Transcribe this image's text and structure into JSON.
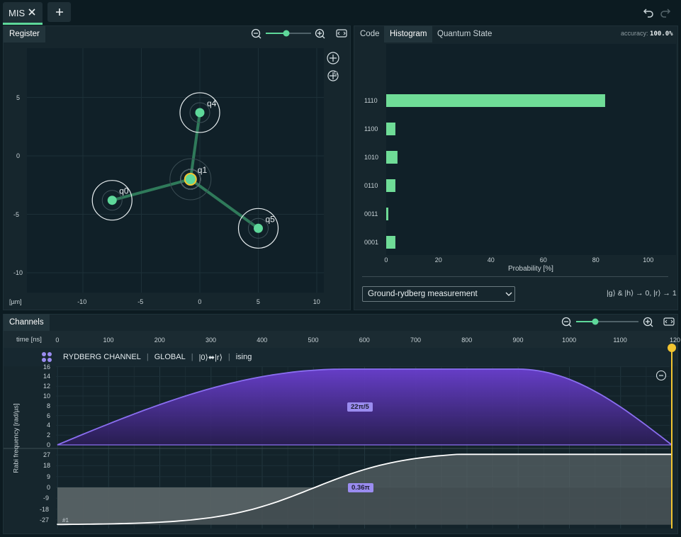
{
  "tabs": {
    "mis": "MIS"
  },
  "register": {
    "tab": "Register",
    "unit": "[µm]",
    "yticks": [
      "5",
      "0",
      "-5",
      "-10"
    ],
    "xticks": [
      "-10",
      "-5",
      "0",
      "5",
      "10"
    ],
    "atoms": [
      {
        "name": "q0",
        "x": -7.5,
        "y": -3.8
      },
      {
        "name": "q1",
        "x": -0.8,
        "y": -2.0
      },
      {
        "name": "q4",
        "x": 0.0,
        "y": 3.7
      },
      {
        "name": "q5",
        "x": 5.0,
        "y": -6.2
      }
    ],
    "links": [
      [
        "q0",
        "q1"
      ],
      [
        "q1",
        "q4"
      ],
      [
        "q1",
        "q5"
      ]
    ]
  },
  "results": {
    "tabs": [
      "Code",
      "Histogram",
      "Quantum State"
    ],
    "active_tab": "Histogram",
    "accuracy_label": "accuracy:",
    "accuracy_value": "100.0%",
    "measurement": "Ground-rydberg measurement",
    "measurement_rule": "|g⟩ & |h⟩ → 0, |r⟩ → 1"
  },
  "chart_data": {
    "type": "bar",
    "orientation": "horizontal",
    "categories": [
      "1110",
      "1100",
      "1010",
      "0110",
      "0011",
      "0001"
    ],
    "values": [
      83.5,
      3.5,
      4.3,
      3.5,
      0.8,
      3.5
    ],
    "xlabel": "Probability [%]",
    "xticks": [
      "0",
      "20",
      "40",
      "60",
      "80",
      "100"
    ],
    "xlim": [
      0,
      110
    ],
    "color": "#6fdc97"
  },
  "channels": {
    "tab": "Channels",
    "time_label": "time [ns]",
    "time_ticks": [
      "0",
      "100",
      "200",
      "300",
      "400",
      "500",
      "600",
      "700",
      "800",
      "900",
      "1000",
      "1100",
      "120"
    ],
    "channel_name": "RYDBERG CHANNEL",
    "addressing": "GLOBAL",
    "basis": "|0⟩⬌|r⟩",
    "mode": "ising",
    "rabi_axis_label": "Rabi frequency [rad/µs]",
    "amp_ticks": [
      "16",
      "14",
      "12",
      "10",
      "8",
      "6",
      "4",
      "2",
      "0"
    ],
    "det_ticks": [
      "27",
      "18",
      "9",
      "0",
      "-9",
      "-18",
      "-27"
    ],
    "amplitude_area": "22π/5",
    "detuning_area": "0.36π",
    "pulse_index": "#1",
    "amplitude_color": "#8a6ef0",
    "detuning_color": "#ffffff",
    "cursor_color": "#f2c430"
  }
}
